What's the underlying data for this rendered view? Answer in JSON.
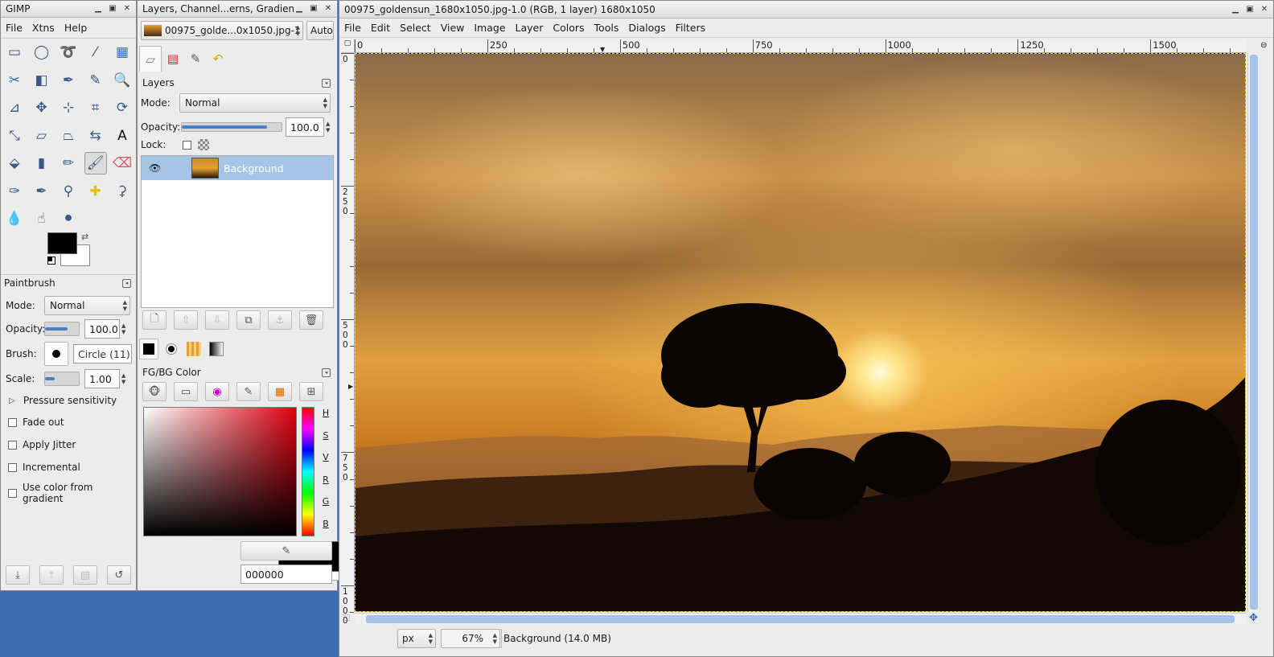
{
  "toolbox": {
    "title": "GIMP",
    "menu": [
      "File",
      "Xtns",
      "Help"
    ],
    "tool_icons": [
      "rect-select-icon",
      "ellipse-select-icon",
      "free-select-icon",
      "fuzzy-select-icon",
      "color-select-icon",
      "scissors-icon",
      "foreground-select-icon",
      "paths-icon",
      "color-picker-icon",
      "zoom-icon",
      "measure-icon",
      "move-icon",
      "align-icon",
      "crop-icon",
      "rotate-icon",
      "scale-icon",
      "shear-icon",
      "perspective-icon",
      "flip-icon",
      "text-icon",
      "bucket-fill-icon",
      "blend-icon",
      "pencil-icon",
      "paintbrush-icon",
      "eraser-icon",
      "airbrush-icon",
      "ink-icon",
      "clone-icon",
      "heal-icon",
      "perspective-clone-icon",
      "blur-icon",
      "smudge-icon",
      "dodge-burn-icon"
    ],
    "tool_options": {
      "title": "Paintbrush",
      "mode_label": "Mode:",
      "mode_value": "Normal",
      "opacity_label": "Opacity:",
      "opacity_value": "100.0",
      "brush_label": "Brush:",
      "brush_value": "Circle (11)",
      "scale_label": "Scale:",
      "scale_value": "1.00",
      "pressure_label": "Pressure sensitivity",
      "fade_label": "Fade out",
      "jitter_label": "Apply Jitter",
      "incremental_label": "Incremental",
      "gradient_label": "Use color from gradient"
    }
  },
  "layers_dock": {
    "title": "Layers, Channel...erns, Gradients",
    "image_combo": "00975_golde...0x1050.jpg-1",
    "auto_label": "Auto",
    "layers_title": "Layers",
    "mode_label": "Mode:",
    "mode_value": "Normal",
    "opacity_label": "Opacity:",
    "opacity_value": "100.0",
    "lock_label": "Lock:",
    "layer_name": "Background",
    "fgbg_title": "FG/BG Color",
    "channel_labels": [
      "H",
      "S",
      "V",
      "R",
      "G",
      "B"
    ],
    "hex_value": "000000"
  },
  "image_window": {
    "title": "00975_goldensun_1680x1050.jpg-1.0 (RGB, 1 layer) 1680x1050",
    "menu": [
      "File",
      "Edit",
      "Select",
      "View",
      "Image",
      "Layer",
      "Colors",
      "Tools",
      "Dialogs",
      "Filters"
    ],
    "hruler_ticks": [
      "0",
      "250",
      "500",
      "750",
      "1000",
      "1250",
      "1500"
    ],
    "vruler_ticks": [
      "0",
      "250",
      "500",
      "750",
      "1000"
    ],
    "unit": "px",
    "zoom": "67%",
    "status": "Background (14.0 MB)"
  },
  "colors": {
    "accent": "#4a80c8",
    "selected_row": "#a6c4e6",
    "fg": "#000000",
    "bg": "#ffffff"
  }
}
